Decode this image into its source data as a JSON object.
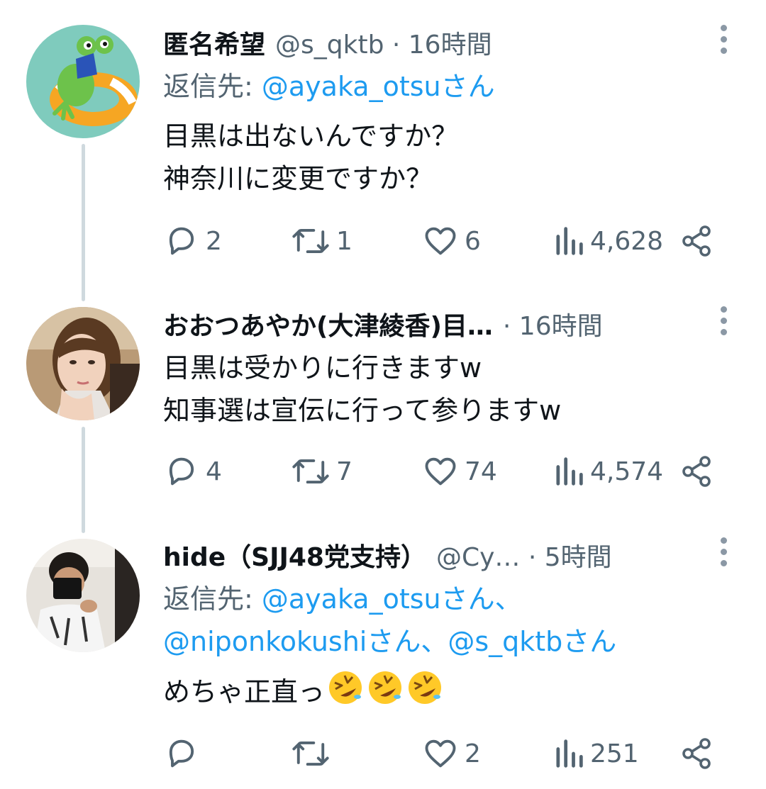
{
  "tweets": [
    {
      "name": "匿名希望",
      "meta": "@s_qktb · 16時間",
      "reply_prefix": "返信先: ",
      "reply_mentions": [
        "@ayaka_otsuさん"
      ],
      "text_lines": [
        "目黒は出ないんですか？",
        "神奈川に変更ですか？"
      ],
      "counts": {
        "replies": "2",
        "retweets": "1",
        "likes": "6",
        "views": "4,628"
      }
    },
    {
      "name": "おおつあやか(大津綾香)目…",
      "meta": "· 16時間",
      "text_lines": [
        "目黒は受かりに行きますw",
        "知事選は宣伝に行って参りますw"
      ],
      "counts": {
        "replies": "4",
        "retweets": "7",
        "likes": "74",
        "views": "4,574"
      }
    },
    {
      "name": "hide（SJJ48党支持）",
      "meta": "@Cy…  · 5時間",
      "reply_prefix": "返信先: ",
      "reply_mentions": [
        "@ayaka_otsuさん、",
        "@niponkokushiさん、",
        "@s_qktbさん"
      ],
      "text_lines": [
        "めちゃ正直っ"
      ],
      "emoji": [
        "rolling-on-floor-laughing",
        "rolling-on-floor-laughing",
        "rolling-on-floor-laughing"
      ],
      "counts": {
        "replies": "",
        "retweets": "",
        "likes": "2",
        "views": "251"
      }
    }
  ],
  "colors": {
    "text": "#0f1419",
    "secondary": "#536471",
    "link": "#1d9bf0",
    "thread_line": "#cfd9de"
  }
}
